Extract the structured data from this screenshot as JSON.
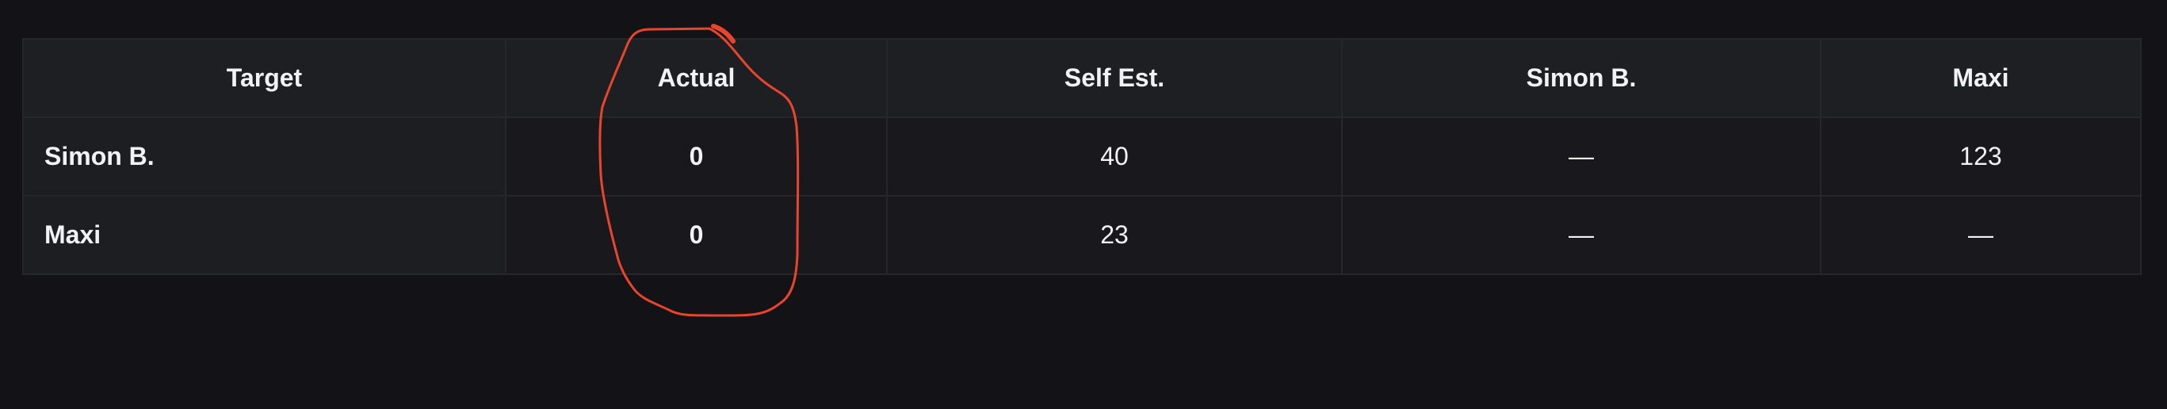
{
  "table": {
    "columns": [
      "Target",
      "Actual",
      "Self Est.",
      "Simon B.",
      "Maxi"
    ],
    "rows": [
      {
        "target": "Simon B.",
        "actual": "0",
        "self_est": "40",
        "simon_b": "—",
        "maxi": "123"
      },
      {
        "target": "Maxi",
        "actual": "0",
        "self_est": "23",
        "simon_b": "—",
        "maxi": "—"
      }
    ]
  },
  "colors": {
    "background": "#131317",
    "header_bg": "#1e1f23",
    "row_bg": "#19191d",
    "name_cell_bg": "#1d1e22",
    "border": "#26272c",
    "text": "#f2f2f4",
    "annotation_stroke": "#e8452c"
  }
}
